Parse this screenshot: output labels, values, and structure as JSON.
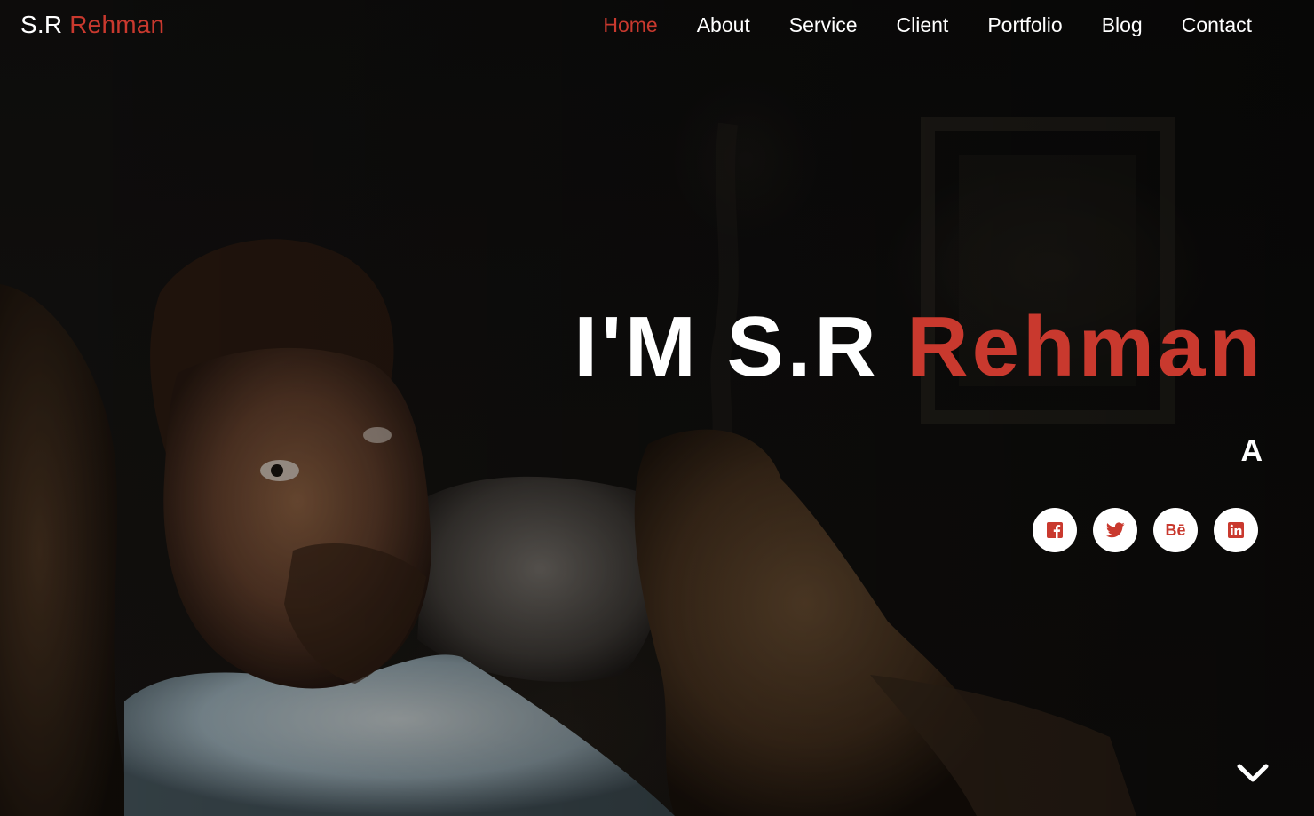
{
  "brand": {
    "first": "S.R ",
    "accent": "Rehman"
  },
  "nav": {
    "items": [
      {
        "label": "Home",
        "active": true
      },
      {
        "label": "About",
        "active": false
      },
      {
        "label": "Service",
        "active": false
      },
      {
        "label": "Client",
        "active": false
      },
      {
        "label": "Portfolio",
        "active": false
      },
      {
        "label": "Blog",
        "active": false
      },
      {
        "label": "Contact",
        "active": false
      }
    ]
  },
  "hero": {
    "headline_prefix": "I'M S.R ",
    "headline_accent": "Rehman",
    "typed_text": "A"
  },
  "socials": [
    {
      "icon": "facebook-icon"
    },
    {
      "icon": "twitter-icon"
    },
    {
      "icon": "behance-icon",
      "glyph": "Bē"
    },
    {
      "icon": "linkedin-icon"
    }
  ],
  "scroll": {
    "icon": "chevron-down-icon"
  },
  "colors": {
    "accent": "#c9392e",
    "text": "#ffffff",
    "background": "#0e0d0c"
  }
}
